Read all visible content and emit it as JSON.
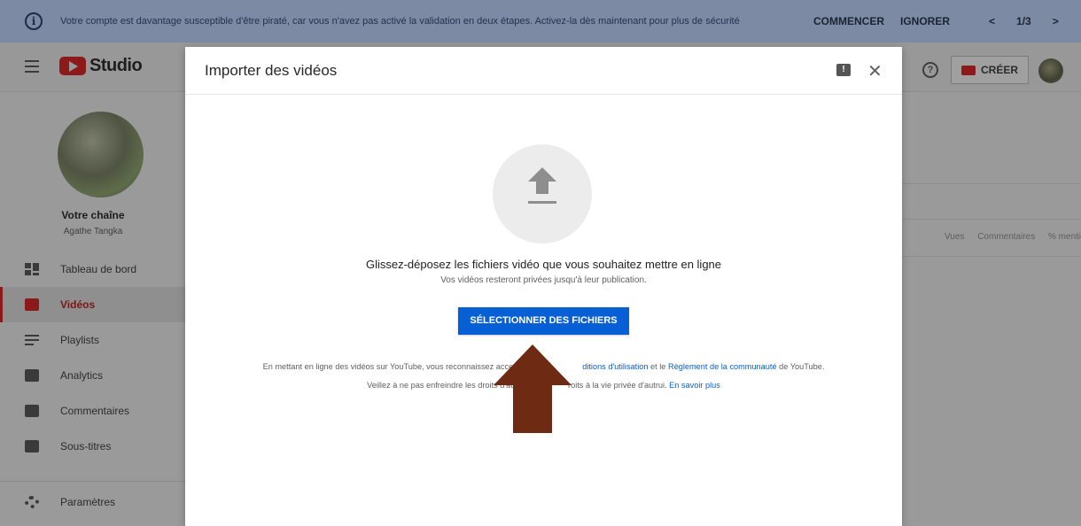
{
  "banner": {
    "message": "Votre compte est davantage susceptible d'être piraté, car vous n'avez pas activé la validation en deux étapes. Activez-la dès maintenant pour plus de sécurité",
    "start_label": "COMMENCER",
    "ignore_label": "IGNORER",
    "pager": "1/3",
    "prev": "<",
    "next": ">"
  },
  "header": {
    "logo_text": "Studio",
    "create_label": "CRÉER"
  },
  "sidebar": {
    "channel_title": "Votre chaîne",
    "channel_name": "Agathe Tangka",
    "items": [
      {
        "label": "Tableau de bord",
        "icon": "dashboard-icon"
      },
      {
        "label": "Vidéos",
        "icon": "videos-icon"
      },
      {
        "label": "Playlists",
        "icon": "playlist-icon"
      },
      {
        "label": "Analytics",
        "icon": "analytics-icon"
      },
      {
        "label": "Commentaires",
        "icon": "comments-icon"
      },
      {
        "label": "Sous-titres",
        "icon": "subtitles-icon"
      }
    ],
    "settings_label": "Paramètres"
  },
  "background": {
    "col_views": "Vues",
    "col_comments": "Commentaires",
    "col_likes": "% mentio"
  },
  "modal": {
    "title": "Importer des vidéos",
    "drop_title": "Glissez-déposez les fichiers vidéo que vous souhaitez mettre en ligne",
    "drop_sub": "Vos vidéos resteront privées jusqu'à leur publication.",
    "select_button": "SÉLECTIONNER DES FICHIERS",
    "legal1_pre": "En mettant en ligne des vidéos sur YouTube, vous reconnaissez acce",
    "legal1_link1": "ditions d'utilisation",
    "legal1_mid": " et le ",
    "legal1_link2": "Règlement de la communauté",
    "legal1_post": " de YouTube.",
    "legal2_pre": "Veillez à ne pas enfreindre les droits d'aute",
    "legal2_mid": "roits à la vie privée d'autrui. ",
    "legal2_link": "En savoir plus"
  },
  "colors": {
    "accent_blue": "#065fd4",
    "annotation_arrow": "#6e2a12",
    "brand_red": "#8c1a1a"
  }
}
